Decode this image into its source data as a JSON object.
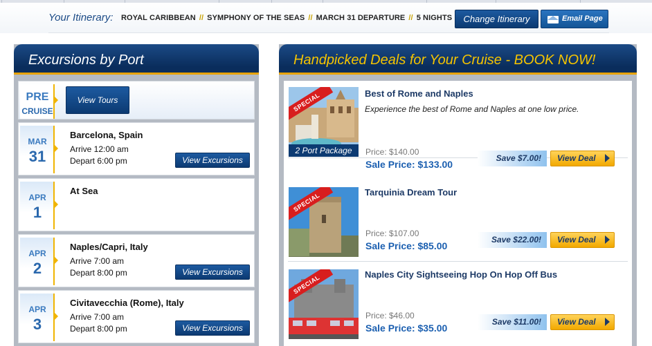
{
  "itinerary": {
    "label": "Your Itinerary:",
    "cruise_line": "ROYAL CARIBBEAN",
    "ship": "SYMPHONY OF THE SEAS",
    "departure": "MARCH 31 DEPARTURE",
    "nights": "5 NIGHTS",
    "separator": "//",
    "change_label": "Change Itinerary",
    "email_label": "Email Page"
  },
  "excursions": {
    "title": "Excursions by Port",
    "pre": {
      "line1": "PRE",
      "line2": "CRUISE",
      "button": "View Tours"
    },
    "ports": [
      {
        "month": "MAR",
        "day": "31",
        "name": "Barcelona, Spain",
        "arrive": "Arrive 12:00 am",
        "depart": "Depart 6:00 pm",
        "button": "View Excursions"
      },
      {
        "month": "APR",
        "day": "1",
        "name": "At Sea",
        "arrive": "",
        "depart": "",
        "button": ""
      },
      {
        "month": "APR",
        "day": "2",
        "name": "Naples/Capri, Italy",
        "arrive": "Arrive 7:00 am",
        "depart": "Depart 8:00 pm",
        "button": "View Excursions"
      },
      {
        "month": "APR",
        "day": "3",
        "name": "Civitavecchia (Rome), Italy",
        "arrive": "Arrive 7:00 am",
        "depart": "Depart 8:00 pm",
        "button": "View Excursions"
      }
    ]
  },
  "deals": {
    "title": "Handpicked Deals for Your Cruise - BOOK NOW!",
    "special_label": "SPECIAL",
    "view_deal_label": "View Deal",
    "items": [
      {
        "title": "Best of Rome and Naples",
        "description": "Experience the best of Rome and Naples at one low price.",
        "price": "Price: $140.00",
        "sale_price": "Sale Price: $133.00",
        "save": "Save $7.00!",
        "badge": "2 Port Package"
      },
      {
        "title": "Tarquinia Dream Tour",
        "description": "",
        "price": "Price: $107.00",
        "sale_price": "Sale Price: $85.00",
        "save": "Save $22.00!",
        "badge": ""
      },
      {
        "title": "Naples City Sightseeing Hop On Hop Off Bus",
        "description": "",
        "price": "Price: $46.00",
        "sale_price": "Sale Price: $35.00",
        "save": "Save $11.00!",
        "badge": ""
      }
    ]
  },
  "colors": {
    "navy": "#0c3a72",
    "gold": "#f5c400",
    "accent_orange": "#f0b400",
    "sale_blue": "#1b5fb0"
  }
}
